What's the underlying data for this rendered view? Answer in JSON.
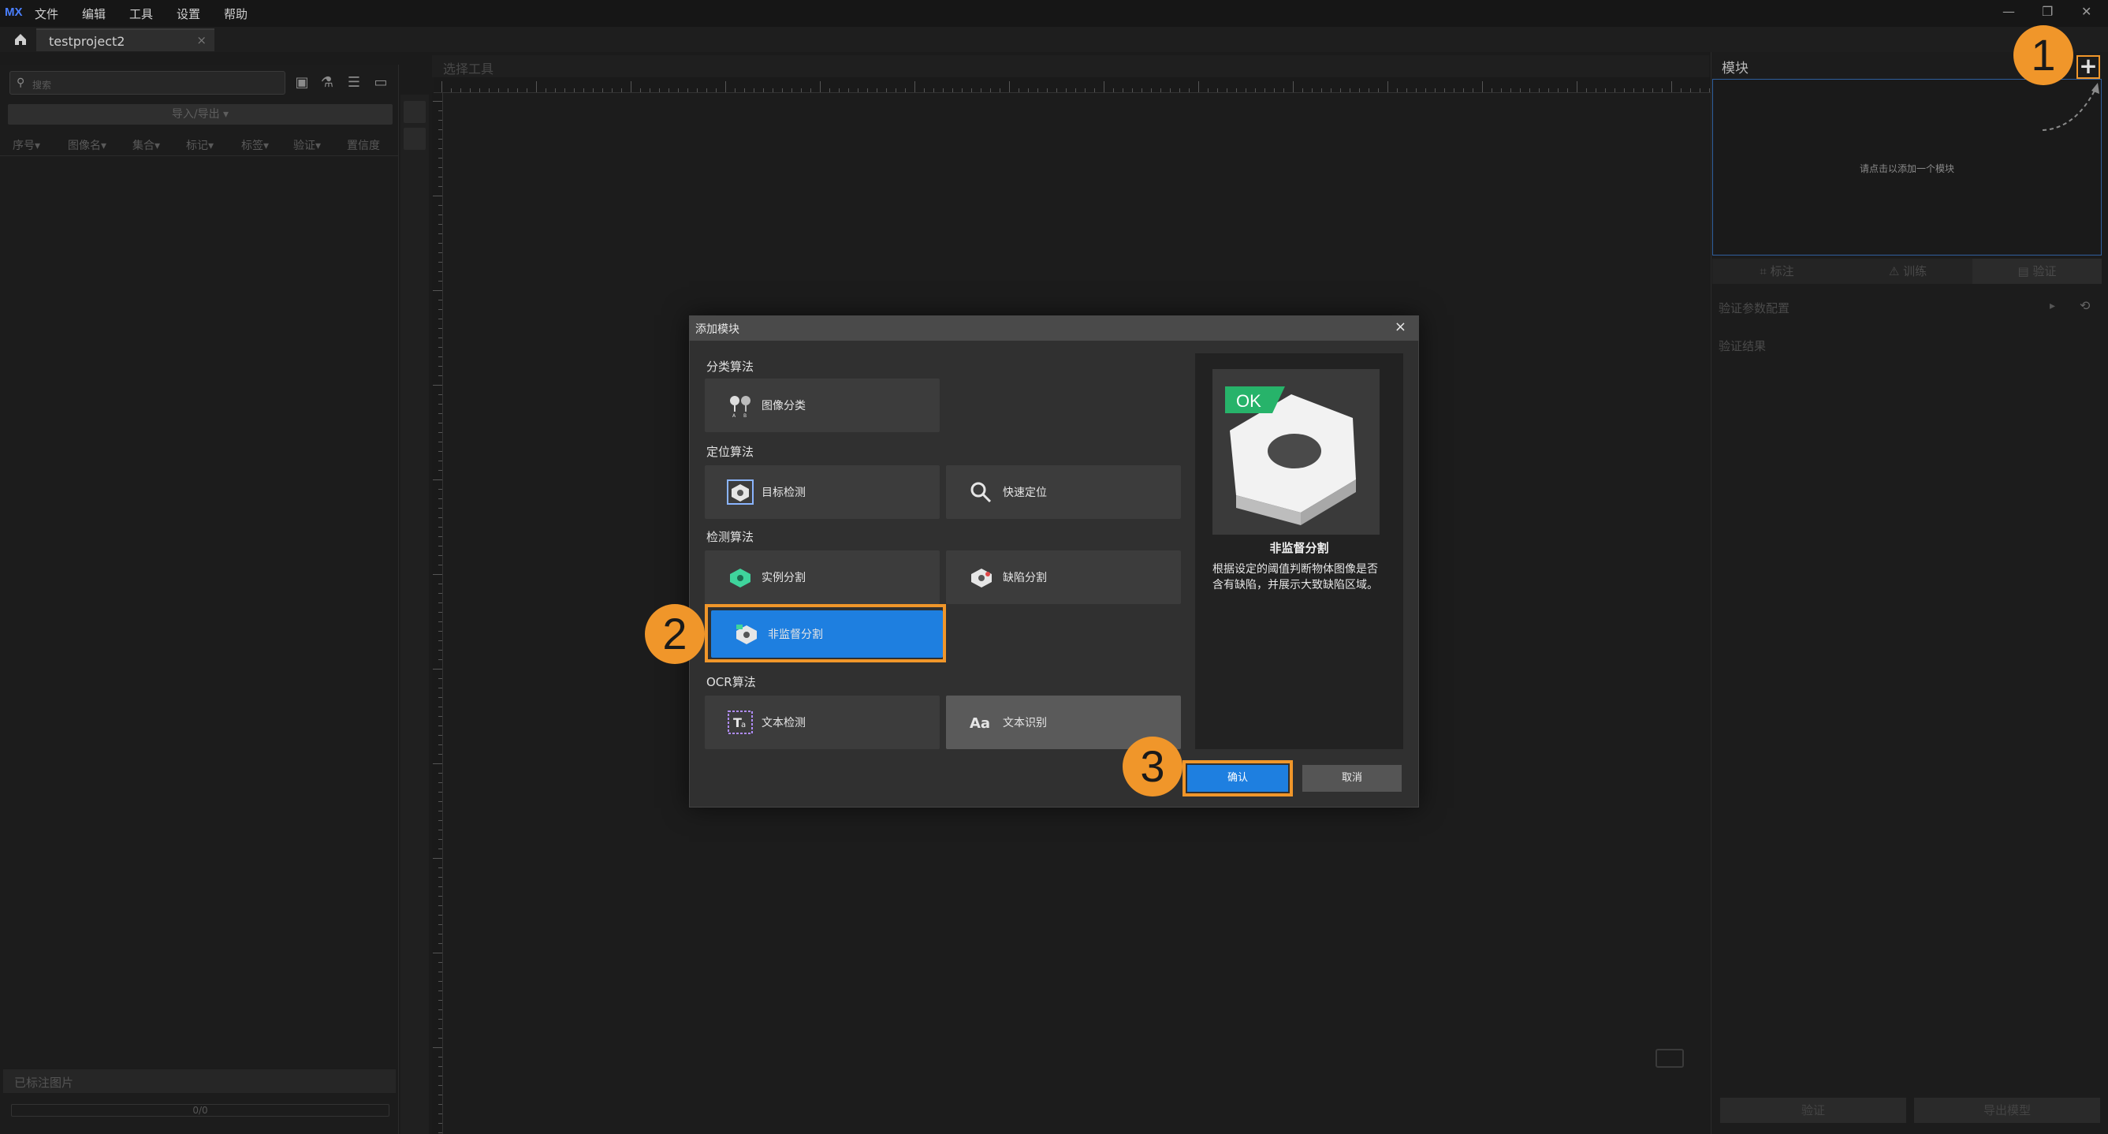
{
  "app": {
    "logo": "MX",
    "menu": [
      "文件",
      "编辑",
      "工具",
      "设置",
      "帮助"
    ],
    "window_controls": [
      "—",
      "❐",
      "✕"
    ]
  },
  "tab": {
    "title": "testproject2",
    "close": "×"
  },
  "left_panel": {
    "search_placeholder": "搜索",
    "import_export_label": "导入/导出 ▾",
    "columns": [
      "序号▾",
      "图像名▾",
      "集合▾",
      "标记▾",
      "标签▾",
      "验证▾",
      "置信度"
    ],
    "annotated_label": "已标注图片",
    "progress_text": "0/0"
  },
  "center": {
    "title": "选择工具"
  },
  "right_panel": {
    "title": "模块",
    "add_icon": "+",
    "hint": "请点击以添加一个模块",
    "tabs": [
      "标注",
      "训练",
      "验证"
    ],
    "verify_config": "验证参数配置",
    "verify_result": "验证结果",
    "verify_button": "验证",
    "export_button": "导出模型"
  },
  "dialog": {
    "title": "添加模块",
    "close": "×",
    "categories": [
      {
        "name": "分类算法",
        "items": [
          "图像分类"
        ]
      },
      {
        "name": "定位算法",
        "items": [
          "目标检测",
          "快速定位"
        ]
      },
      {
        "name": "检测算法",
        "items": [
          "实例分割",
          "缺陷分割",
          "非监督分割"
        ]
      },
      {
        "name": "OCR算法",
        "items": [
          "文本检测",
          "文本识别"
        ]
      }
    ],
    "selected": "非监督分割",
    "preview": {
      "badge": "OK",
      "name": "非监督分割",
      "description": "根据设定的阈值判断物体图像是否含有缺陷，并展示大致缺陷区域。"
    },
    "confirm": "确认",
    "cancel": "取消"
  },
  "step_badges": [
    "1",
    "2",
    "3"
  ],
  "colors": {
    "accent": "#1e7fe0",
    "highlight": "#f0962a",
    "module_border": "#2f5f9e"
  }
}
